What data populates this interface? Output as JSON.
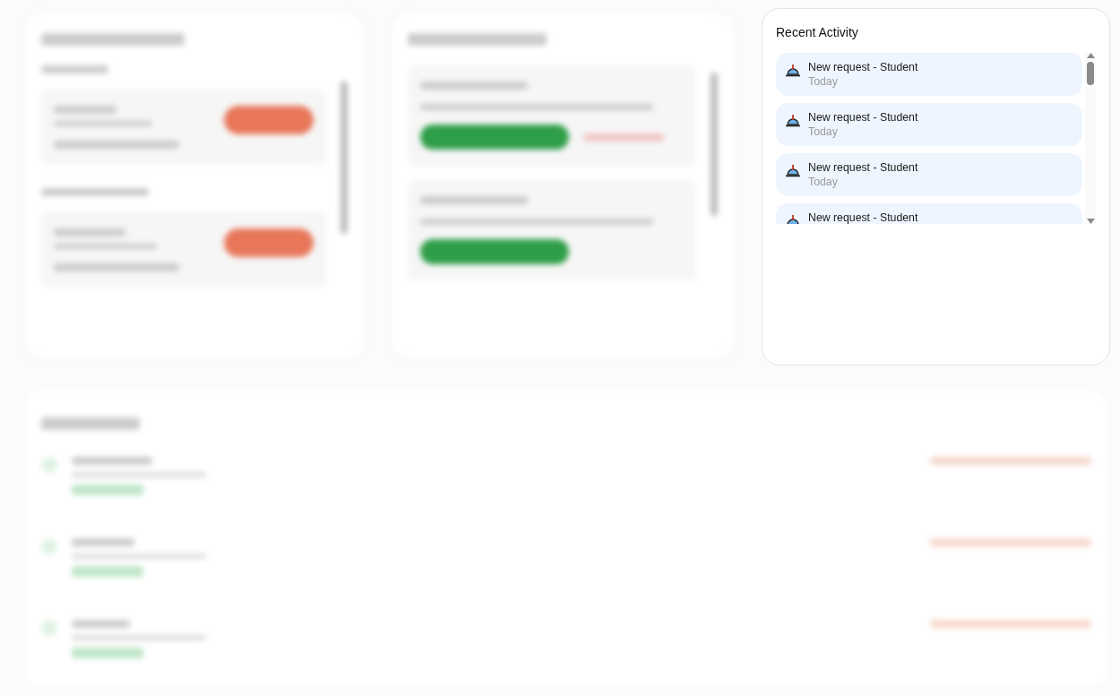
{
  "recent_activity": {
    "title": "Recent Activity",
    "items": [
      {
        "title": "New request - Student",
        "time": "Today"
      },
      {
        "title": "New request - Student",
        "time": "Today"
      },
      {
        "title": "New request - Student",
        "time": "Today"
      },
      {
        "title": "New request - Student"
      }
    ]
  }
}
